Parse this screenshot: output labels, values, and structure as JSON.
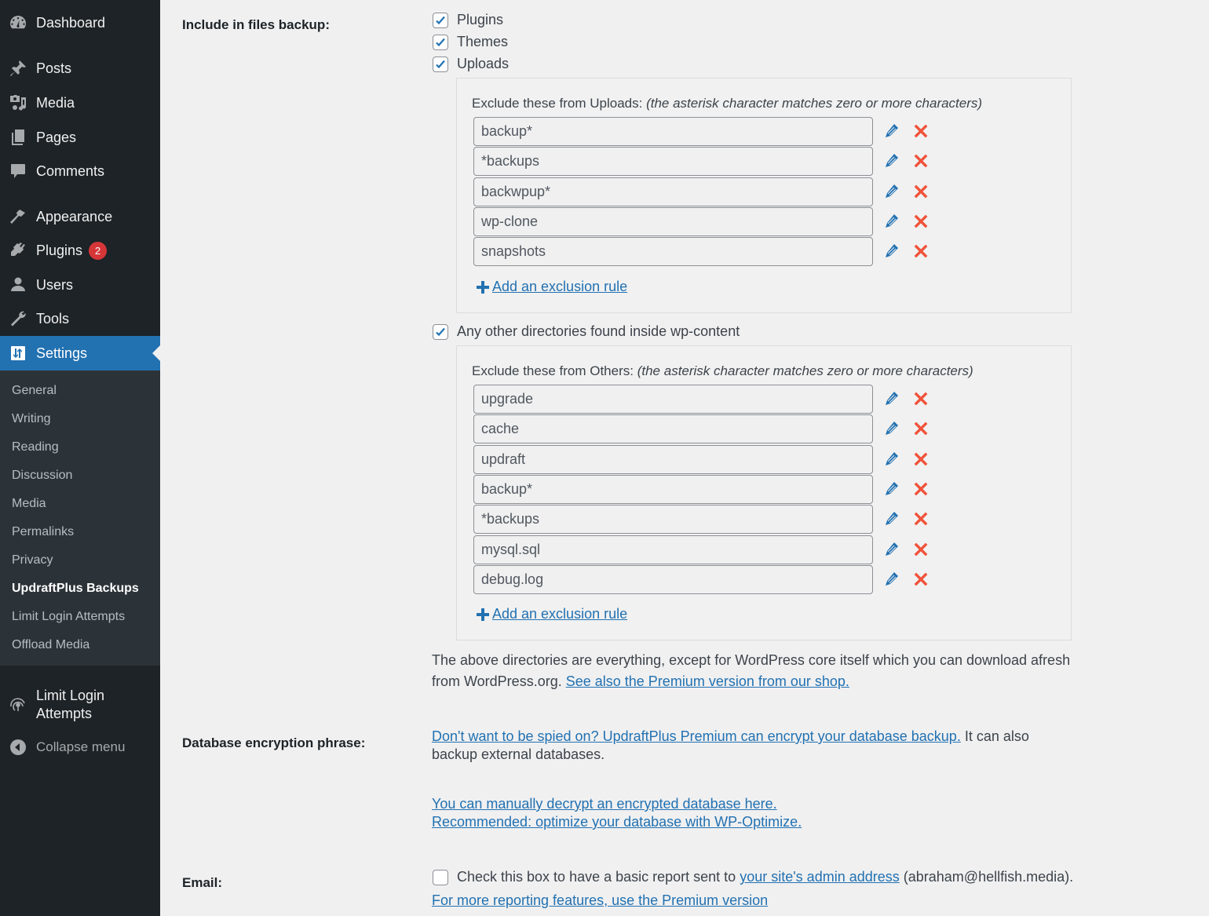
{
  "sidebar": {
    "main_items": [
      {
        "label": "Dashboard",
        "icon": "dashboard-icon"
      },
      {
        "label": "Posts",
        "icon": "pin-icon"
      },
      {
        "label": "Media",
        "icon": "media-icon"
      },
      {
        "label": "Pages",
        "icon": "pages-icon"
      },
      {
        "label": "Comments",
        "icon": "comment-icon"
      },
      {
        "label": "Appearance",
        "icon": "brush-icon"
      },
      {
        "label": "Plugins",
        "icon": "plugin-icon",
        "badge": "2"
      },
      {
        "label": "Users",
        "icon": "user-icon"
      },
      {
        "label": "Tools",
        "icon": "wrench-icon"
      },
      {
        "label": "Settings",
        "icon": "settings-icon",
        "active": true
      }
    ],
    "submenu": [
      {
        "label": "General"
      },
      {
        "label": "Writing"
      },
      {
        "label": "Reading"
      },
      {
        "label": "Discussion"
      },
      {
        "label": "Media"
      },
      {
        "label": "Permalinks"
      },
      {
        "label": "Privacy"
      },
      {
        "label": "UpdraftPlus Backups",
        "current": true
      },
      {
        "label": "Limit Login Attempts"
      },
      {
        "label": "Offload Media"
      }
    ],
    "limit_login": {
      "line1": "Limit Login",
      "line2": "Attempts"
    },
    "collapse": "Collapse menu"
  },
  "files_backup": {
    "label": "Include in files backup:",
    "options": [
      {
        "label": "Plugins",
        "checked": true
      },
      {
        "label": "Themes",
        "checked": true
      },
      {
        "label": "Uploads",
        "checked": true
      }
    ],
    "uploads_exclude": {
      "title": "Exclude these from Uploads:",
      "hint": "(the asterisk character matches zero or more characters)",
      "rules": [
        "backup*",
        "*backups",
        "backwpup*",
        "wp-clone",
        "snapshots"
      ],
      "add_label": "Add an exclusion rule"
    },
    "others": {
      "label": "Any other directories found inside wp-content",
      "checked": true
    },
    "others_exclude": {
      "title": "Exclude these from Others:",
      "hint": "(the asterisk character matches zero or more characters)",
      "rules": [
        "upgrade",
        "cache",
        "updraft",
        "backup*",
        "*backups",
        "mysql.sql",
        "debug.log"
      ],
      "add_label": "Add an exclusion rule"
    },
    "note_text": "The above directories are everything, except for WordPress core itself which you can download afresh from WordPress.org.",
    "note_link": "See also the Premium version from our shop."
  },
  "db_encryption": {
    "label": "Database encryption phrase:",
    "premium_link": "Don't want to be spied on? UpdraftPlus Premium can encrypt your database backup.",
    "premium_text": "It can also backup external databases.",
    "decrypt_link": "You can manually decrypt an encrypted database here.",
    "optimize_link": "Recommended: optimize your database with WP-Optimize."
  },
  "email": {
    "label": "Email:",
    "checked": false,
    "text_before": "Check this box to have a basic report sent to",
    "admin_link": "your site's admin address",
    "text_after": "(abraham@hellfish.media).",
    "premium_link": "For more reporting features, use the Premium version"
  },
  "colors": {
    "sidebar_bg": "#1d2327",
    "submenu_bg": "#2c3338",
    "accent": "#2271b1",
    "badge": "#d63638",
    "delete": "#f0533a"
  }
}
